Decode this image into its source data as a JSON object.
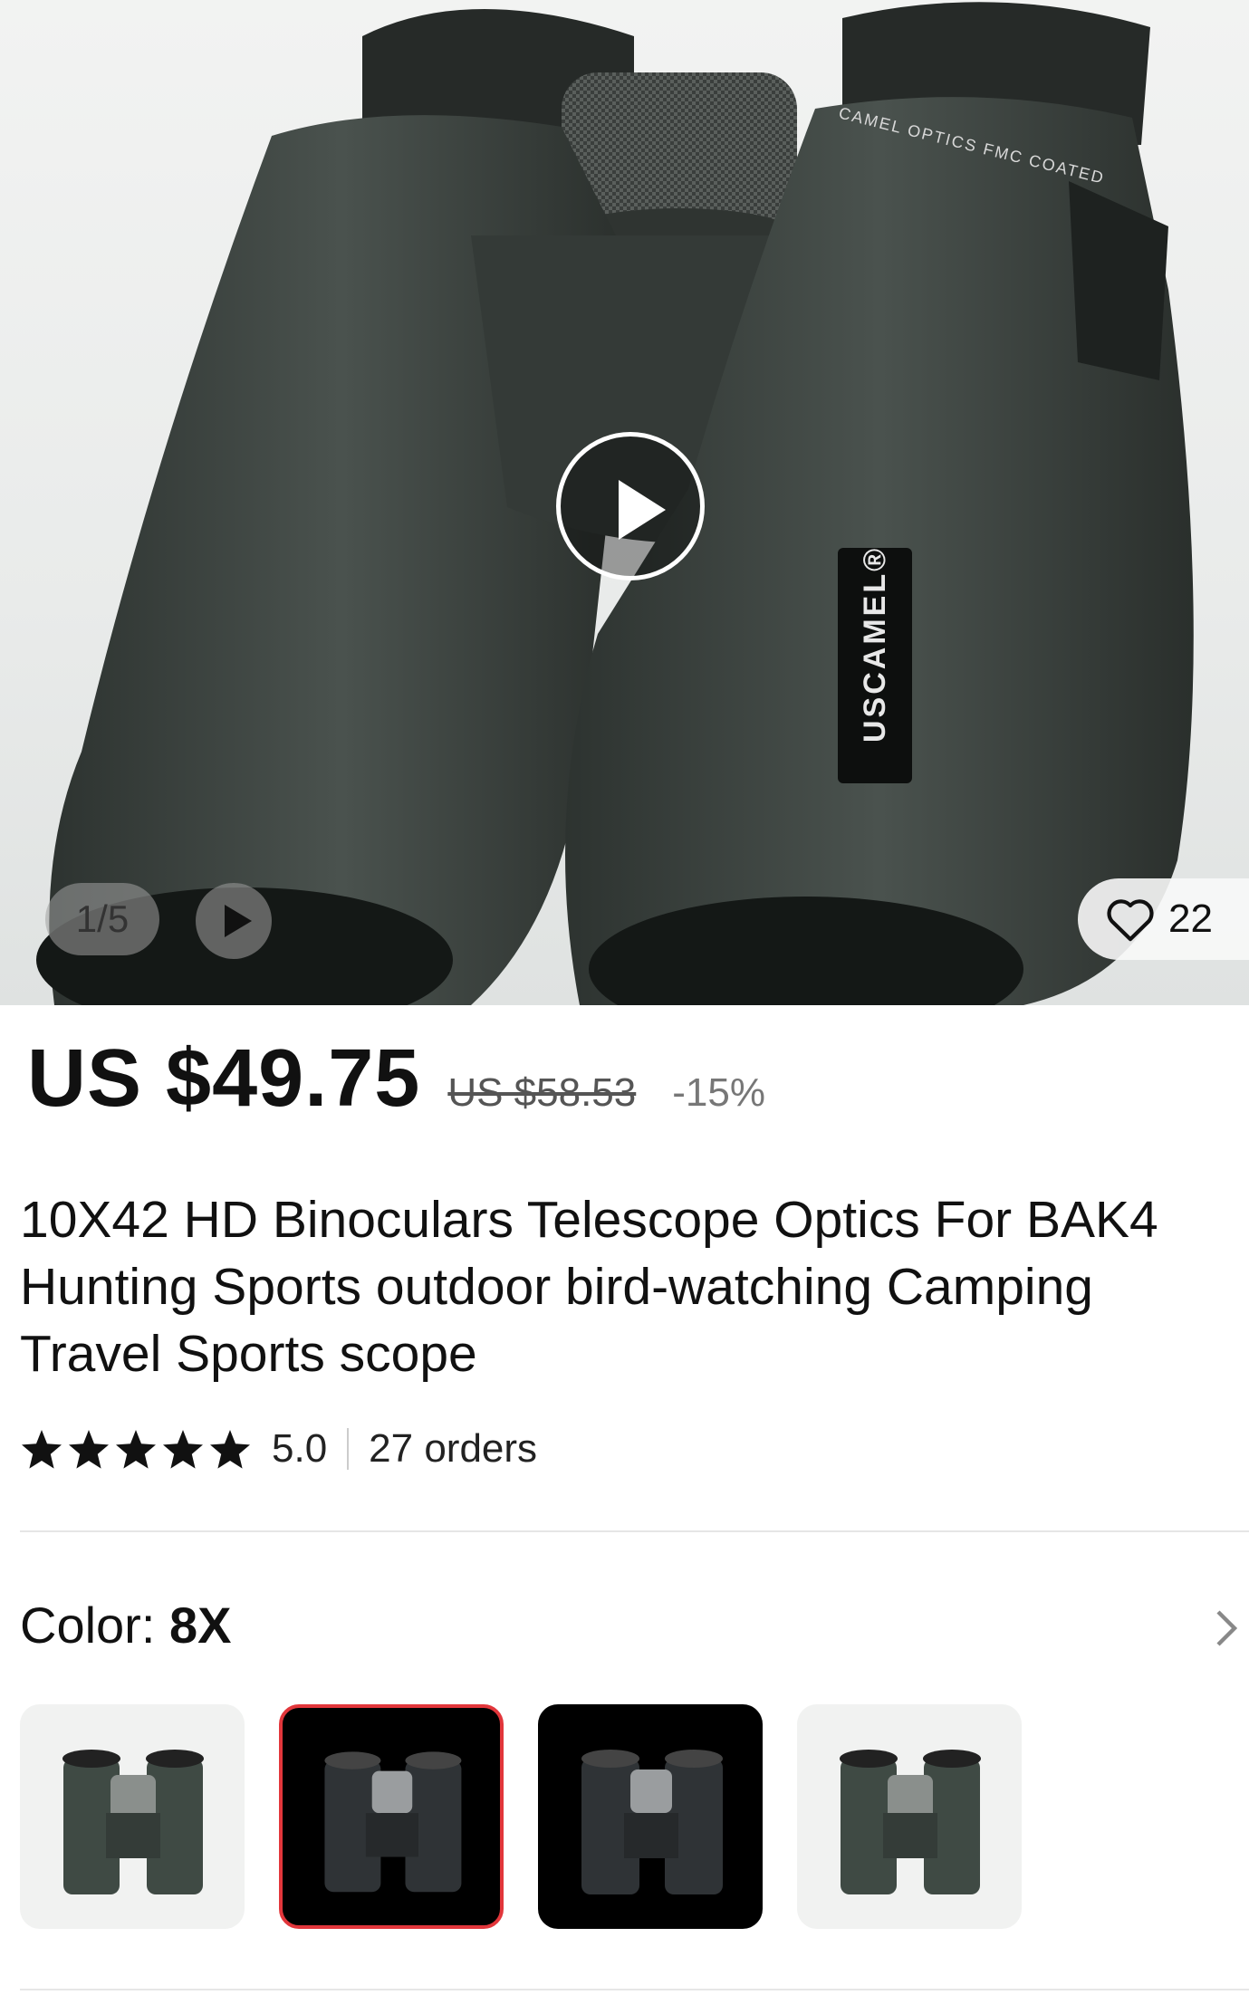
{
  "gallery": {
    "counter": "1/5",
    "wishlist_count": "22",
    "image_brand_text": "USCAMEL®",
    "image_lens_text": "CAMEL OPTICS FMC COATED"
  },
  "product": {
    "price": "US $49.75",
    "original_price": "US $58.53",
    "discount": "-15%",
    "title": "10X42 HD Binoculars Telescope Optics For BAK4 Hunting Sports outdoor bird-watching Camping Travel Sports scope",
    "rating": "5.0",
    "orders": "27 orders",
    "stars": 5
  },
  "variant": {
    "label": "Color: ",
    "selected": "8X",
    "options": [
      {
        "name": "green-binocular",
        "style": "light"
      },
      {
        "name": "black-binocular",
        "style": "dark",
        "selected": true
      },
      {
        "name": "black-binocular-2",
        "style": "dark"
      },
      {
        "name": "green-binocular-2",
        "style": "light"
      }
    ]
  },
  "colors": {
    "selected_border": "#e2363b",
    "binocular_body": "#3e4541"
  }
}
